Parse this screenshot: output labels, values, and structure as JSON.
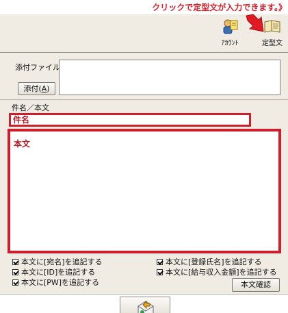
{
  "annotation": {
    "text": "クリックで定型文が入力できます。》"
  },
  "toolbar": {
    "account_label": "ｱｶｳﾝﾄ",
    "template_label": "定型文"
  },
  "attach": {
    "label": "添付ファイル",
    "button_label_prefix": "添付(",
    "button_label_key": "A",
    "button_label_suffix": ")"
  },
  "compose": {
    "label": "件名／本文",
    "subject_placeholder": "件名",
    "body_placeholder": "本文"
  },
  "options": {
    "left": [
      {
        "label": "本文に[宛名]を追記する",
        "checked": true
      },
      {
        "label": "本文に[ID]を追記する",
        "checked": true
      },
      {
        "label": "本文に[PW]を追記する",
        "checked": true
      }
    ],
    "right": [
      {
        "label": "本文に[登録氏名]を追記する",
        "checked": true
      },
      {
        "label": "本文に[給与収入金額]を追記する",
        "checked": true
      }
    ]
  },
  "confirm_button": "本文確認",
  "colors": {
    "highlight": "#cc1e2c",
    "panel": "#f0ece3",
    "annotation_text": "#d21f2a"
  }
}
